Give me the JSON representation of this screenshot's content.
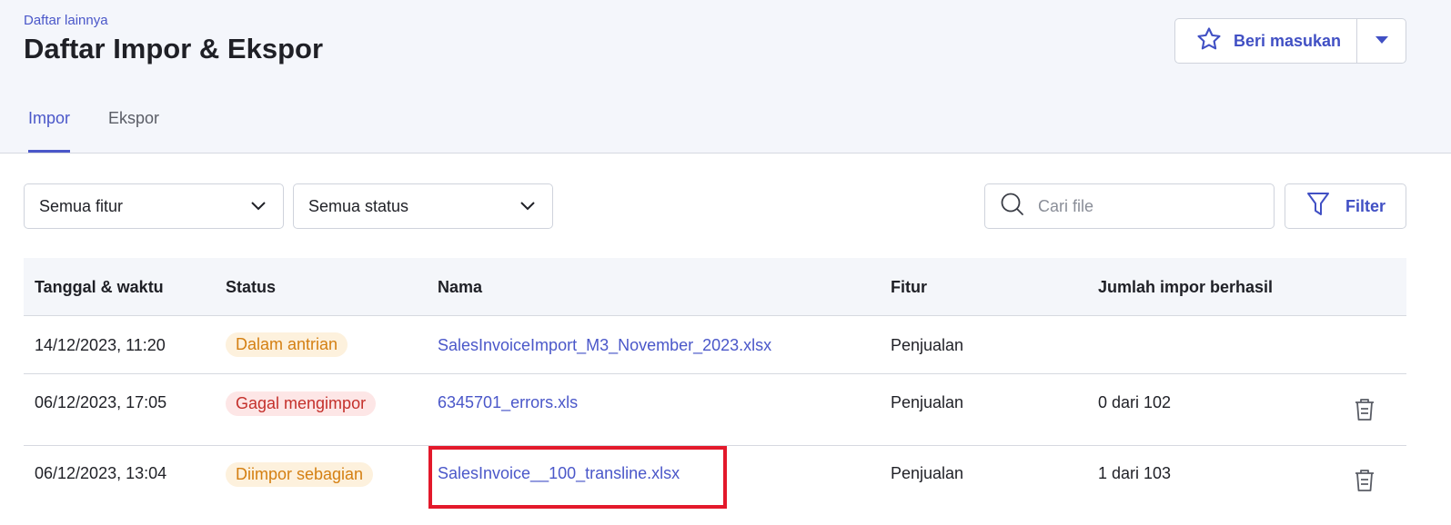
{
  "header": {
    "breadcrumb": "Daftar lainnya",
    "title": "Daftar Impor & Ekspor",
    "feedback_label": "Beri masukan"
  },
  "tabs": [
    {
      "label": "Impor",
      "active": true
    },
    {
      "label": "Ekspor",
      "active": false
    }
  ],
  "filters": {
    "feature_select": "Semua fitur",
    "status_select": "Semua status",
    "search_placeholder": "Cari file",
    "filter_label": "Filter"
  },
  "table": {
    "columns": [
      "Tanggal & waktu",
      "Status",
      "Nama",
      "Fitur",
      "Jumlah impor berhasil"
    ],
    "rows": [
      {
        "datetime": "14/12/2023, 11:20",
        "status": "Dalam antrian",
        "name": "SalesInvoiceImport_M3_November_2023.xlsx",
        "feature": "Penjualan",
        "count": ""
      },
      {
        "datetime": "06/12/2023, 17:05",
        "status": "Gagal mengimpor",
        "name": "6345701_errors.xls",
        "feature": "Penjualan",
        "count": "0 dari 102"
      },
      {
        "datetime": "06/12/2023, 13:04",
        "status": "Diimpor sebagian",
        "name": "SalesInvoice__100_transline.xlsx",
        "feature": "Penjualan",
        "count": "1 dari 103"
      }
    ]
  },
  "colors": {
    "accent": "#4a57c9",
    "highlight": "#e3192b",
    "warning_bg": "#fdf1dd",
    "error_bg": "#fde6e6"
  }
}
